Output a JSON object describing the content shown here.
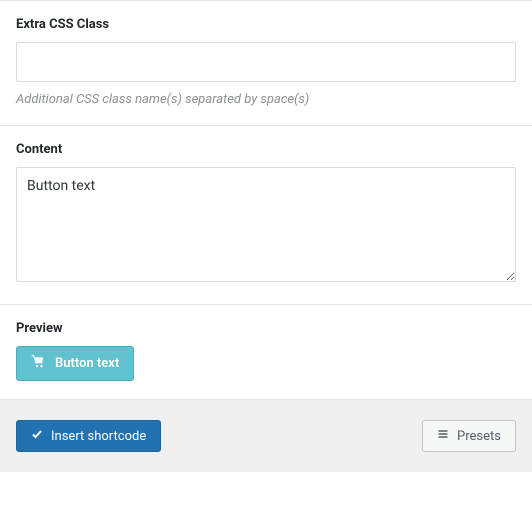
{
  "extra_css": {
    "label": "Extra CSS Class",
    "value": "",
    "helper": "Additional CSS class name(s) separated by space(s)"
  },
  "content": {
    "label": "Content",
    "value": "Button text"
  },
  "preview": {
    "label": "Preview",
    "button_text": "Button text"
  },
  "footer": {
    "insert_label": "Insert shortcode",
    "presets_label": "Presets"
  }
}
